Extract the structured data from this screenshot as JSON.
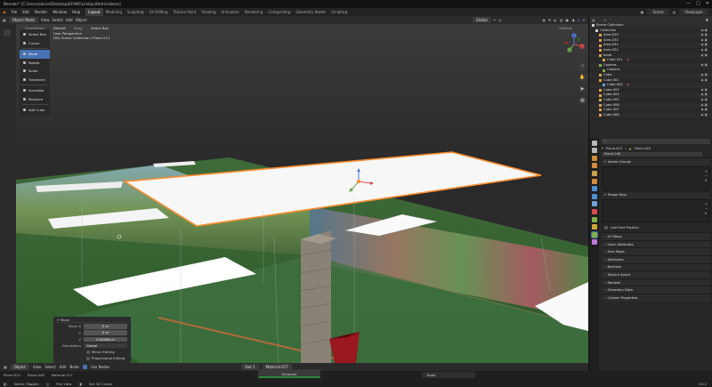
{
  "title_bar": {
    "text": "Blender* [C:\\Users\\daniel\\Desktop\\EFIMO\\Limbiju\\Retrie\\demo]",
    "controls": [
      "—",
      "□",
      "✕"
    ]
  },
  "menu": {
    "items": [
      "File",
      "Edit",
      "Render",
      "Window",
      "Help"
    ],
    "workspaces": [
      "Layout",
      "Modeling",
      "Sculpting",
      "UV Editing",
      "Texture Paint",
      "Shading",
      "Animation",
      "Rendering",
      "Compositing",
      "Geometry Nodes",
      "Scripting"
    ],
    "active_workspace": "Layout",
    "scene": "Scene",
    "view_layer": "ViewLayer"
  },
  "viewport_header": {
    "mode": "Object Mode",
    "menus": [
      "View",
      "Select",
      "Add",
      "Object"
    ],
    "transform": "Global",
    "options": "Options"
  },
  "tool_options": {
    "orientation_label": "Orientation:",
    "orientation_value": "Default",
    "drag_label": "Drag:",
    "drag_value": "Select Box"
  },
  "viewport_info": {
    "line1": "User Perspective",
    "line2": "(69) Scene Collection | Plane.013"
  },
  "tools": [
    {
      "label": "Select Box",
      "active": false
    },
    {
      "label": "Cursor",
      "active": false
    },
    {
      "label": "Move",
      "active": true
    },
    {
      "label": "Rotate",
      "active": false
    },
    {
      "label": "Scale",
      "active": false
    },
    {
      "label": "Transform",
      "active": false
    },
    {
      "label": "Annotate",
      "active": false
    },
    {
      "label": "Measure",
      "active": false
    },
    {
      "label": "Add Cube",
      "active": false
    }
  ],
  "gizmo_axes": [
    "X",
    "Y",
    "Z"
  ],
  "move_panel": {
    "title": "Move",
    "x_label": "Move X",
    "x": "0 m",
    "y_label": "Y",
    "y": "0 m",
    "z_label": "Z",
    "z": "0.00466 m",
    "orientation_label": "Orientation",
    "orientation": "Global",
    "mirror": "Mirror Editing",
    "proportional": "Proportional Editing"
  },
  "bottom_bar": {
    "mode": "Object",
    "menus": [
      "View",
      "Select",
      "Add",
      "Node"
    ],
    "use_nodes": "Use Nodes",
    "slot": "Slot 1",
    "material": "Material.017",
    "filter": "All",
    "node": "Node",
    "emission": "Emission"
  },
  "status_bar": {
    "breadcrumb": [
      "Plane.013",
      "Plane.046",
      "Material.017"
    ],
    "hints": [
      "Select (Toggle)",
      "Pan View",
      "Set 3D Cursor"
    ],
    "version": "3.6.2"
  },
  "outliner": {
    "rows": [
      {
        "name": "Scene Collection",
        "depth": 0,
        "color": "#cfcfcf"
      },
      {
        "name": "Collection",
        "depth": 1,
        "color": "#cfcfcf"
      },
      {
        "name": "Area.029",
        "depth": 2,
        "color": "#e0a24a"
      },
      {
        "name": "Area.030",
        "depth": 2,
        "color": "#e0a24a"
      },
      {
        "name": "Area.031",
        "depth": 2,
        "color": "#e0a24a"
      },
      {
        "name": "Area.032",
        "depth": 2,
        "color": "#e0a24a"
      },
      {
        "name": "bone",
        "depth": 2,
        "color": "#e0a24a"
      },
      {
        "name": "Cube.011",
        "depth": 3,
        "color": "#e0a24a"
      },
      {
        "name": "Camera",
        "depth": 2,
        "color": "#7fb04a"
      },
      {
        "name": "Camera",
        "depth": 3,
        "color": "#7fb04a"
      },
      {
        "name": "Cube",
        "depth": 2,
        "color": "#e0a24a"
      },
      {
        "name": "Cube.001",
        "depth": 2,
        "color": "#e0a24a"
      },
      {
        "name": "Cube.002",
        "depth": 3,
        "color": "#69a0d8"
      },
      {
        "name": "Cube.003",
        "depth": 2,
        "color": "#e0a24a"
      },
      {
        "name": "Cube.004",
        "depth": 2,
        "color": "#e0a24a"
      },
      {
        "name": "Cube.005",
        "depth": 2,
        "color": "#e0a24a"
      },
      {
        "name": "Cube.006",
        "depth": 2,
        "color": "#e0a24a"
      },
      {
        "name": "Cube.007",
        "depth": 2,
        "color": "#e0a24a"
      },
      {
        "name": "Cube.008",
        "depth": 2,
        "color": "#e0a24a"
      }
    ]
  },
  "properties": {
    "breadcrumb_obj": "Plane.013",
    "breadcrumb_data": "Plane.046",
    "data_name": "Plane.046",
    "sections": [
      "Vertex Groups",
      "Shape Keys",
      "UV Maps",
      "Color Attributes",
      "Face Maps",
      "Attributes",
      "Normals",
      "Texture Space",
      "Remesh",
      "Geometry Data",
      "Custom Properties"
    ],
    "tab_colors": [
      "#b8b8b8",
      "#b8b8b8",
      "#d28a3b",
      "#d28a3b",
      "#c9a24e",
      "#d28a3b",
      "#4f8fd0",
      "#4f8fd0",
      "#6ea0d8",
      "#d94a4a",
      "#7fb04a",
      "#d2a43b",
      "#c27ad8",
      "#a0a0a0"
    ],
    "add_rest_position": "Add Rest Position"
  }
}
